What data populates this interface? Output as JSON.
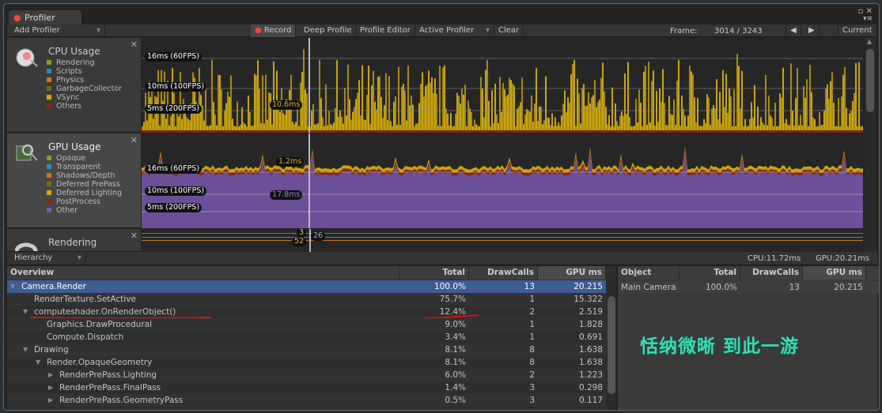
{
  "window": {
    "tab_title": "Profiler"
  },
  "toolbar": {
    "add_profiler": "Add Profiler",
    "record": "Record",
    "deep_profile": "Deep Profile",
    "profile_editor": "Profile Editor",
    "active_profiler": "Active Profiler",
    "clear": "Clear",
    "frame_label": "Frame:",
    "frame_value": "3014 / 3243",
    "current": "Current"
  },
  "cpu": {
    "title": "CPU Usage",
    "legend": [
      {
        "label": "Rendering",
        "color": "#7aa61e"
      },
      {
        "label": "Scripts",
        "color": "#2b8fb4"
      },
      {
        "label": "Physics",
        "color": "#d87a0e"
      },
      {
        "label": "GarbageCollector",
        "color": "#6f6a12"
      },
      {
        "label": "VSync",
        "color": "#d4ae0c"
      },
      {
        "label": "Others",
        "color": "#8a2a10"
      }
    ],
    "lines": [
      "16ms (60FPS)",
      "10ms (100FPS)",
      "5ms (200FPS)"
    ],
    "selected_value": "10.6ms"
  },
  "gpu": {
    "title": "GPU Usage",
    "legend": [
      {
        "label": "Opaque",
        "color": "#7aa61e"
      },
      {
        "label": "Transparent",
        "color": "#2b8fb4"
      },
      {
        "label": "Shadows/Depth",
        "color": "#d87a0e"
      },
      {
        "label": "Deferred PrePass",
        "color": "#6f6a12"
      },
      {
        "label": "Deferred Lighting",
        "color": "#d4ae0c"
      },
      {
        "label": "PostProcess",
        "color": "#8a2a10"
      },
      {
        "label": "Other",
        "color": "#7a5aa8"
      }
    ],
    "lines": [
      "16ms (60FPS)",
      "10ms (100FPS)",
      "5ms (200FPS)"
    ],
    "selected_top": "1.2ms",
    "selected_other": "17.8ms"
  },
  "rendering": {
    "title": "Rendering",
    "values": [
      "3",
      "26",
      "52"
    ]
  },
  "hierarchy": {
    "mode": "Hierarchy",
    "cpu_time": "CPU:11.72ms",
    "gpu_time": "GPU:20.21ms",
    "columns": [
      "Overview",
      "Total",
      "DrawCalls",
      "GPU ms"
    ],
    "rows": [
      {
        "name": "Camera.Render",
        "total": "100.0%",
        "draw": "13",
        "gpu": "20.215",
        "depth": 0,
        "expand": "open",
        "selected": true
      },
      {
        "name": "RenderTexture.SetActive",
        "total": "75.7%",
        "draw": "1",
        "gpu": "15.322",
        "depth": 1,
        "expand": "none"
      },
      {
        "name": "computeshader.OnRenderObject()",
        "total": "12.4%",
        "draw": "2",
        "gpu": "2.519",
        "depth": 1,
        "expand": "open",
        "annotated": true
      },
      {
        "name": "Graphics.DrawProcedural",
        "total": "9.0%",
        "draw": "1",
        "gpu": "1.828",
        "depth": 2,
        "expand": "none"
      },
      {
        "name": "Compute.Dispatch",
        "total": "3.4%",
        "draw": "1",
        "gpu": "0.691",
        "depth": 2,
        "expand": "none"
      },
      {
        "name": "Drawing",
        "total": "8.1%",
        "draw": "8",
        "gpu": "1.638",
        "depth": 1,
        "expand": "open"
      },
      {
        "name": "Render.OpaqueGeometry",
        "total": "8.1%",
        "draw": "8",
        "gpu": "1.638",
        "depth": 2,
        "expand": "open"
      },
      {
        "name": "RenderPrePass.Lighting",
        "total": "6.0%",
        "draw": "2",
        "gpu": "1.223",
        "depth": 3,
        "expand": "closed"
      },
      {
        "name": "RenderPrePass.FinalPass",
        "total": "1.4%",
        "draw": "3",
        "gpu": "0.298",
        "depth": 3,
        "expand": "closed"
      },
      {
        "name": "RenderPrePass.GeometryPass",
        "total": "0.5%",
        "draw": "3",
        "gpu": "0.117",
        "depth": 3,
        "expand": "closed"
      }
    ]
  },
  "objects": {
    "columns": [
      "Object",
      "Total",
      "DrawCalls",
      "GPU ms"
    ],
    "rows": [
      {
        "name": "Main Camera",
        "total": "100.0%",
        "draw": "13",
        "gpu": "20.215"
      }
    ]
  },
  "watermark": "恬纳微晰 到此一游"
}
